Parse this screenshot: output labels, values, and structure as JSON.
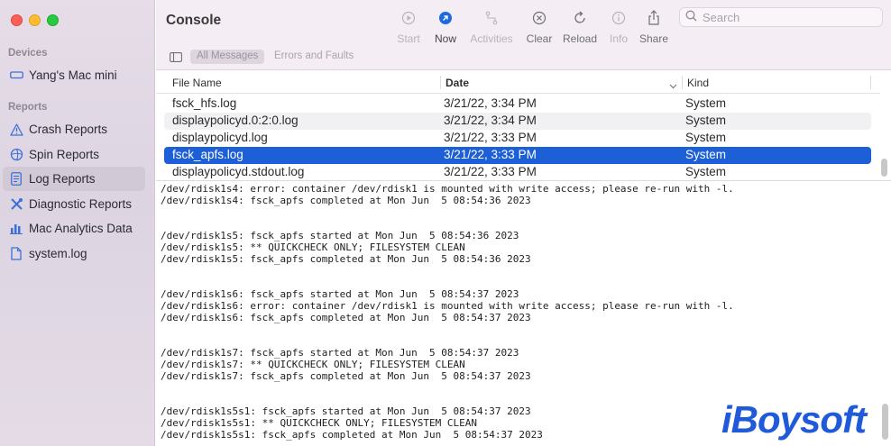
{
  "window": {
    "title": "Console",
    "traffic_lights": {
      "close": "#fd5f57",
      "minimize": "#febc2e",
      "zoom": "#28c840"
    }
  },
  "sidebar": {
    "devices_header": "Devices",
    "device": {
      "label": "Yang's Mac mini",
      "icon": "mac-mini-icon"
    },
    "reports_header": "Reports",
    "items": [
      {
        "label": "Crash Reports",
        "icon": "warning-triangle-icon",
        "selected": false
      },
      {
        "label": "Spin Reports",
        "icon": "spin-icon",
        "selected": false
      },
      {
        "label": "Log Reports",
        "icon": "log-document-icon",
        "selected": true
      },
      {
        "label": "Diagnostic Reports",
        "icon": "tools-icon",
        "selected": false
      },
      {
        "label": "Mac Analytics Data",
        "icon": "bar-chart-icon",
        "selected": false
      },
      {
        "label": "system.log",
        "icon": "file-icon",
        "selected": false
      }
    ]
  },
  "toolbar": {
    "start": "Start",
    "now": "Now",
    "activities": "Activities",
    "clear": "Clear",
    "reload": "Reload",
    "info": "Info",
    "share": "Share",
    "search_placeholder": "Search",
    "filters": {
      "all_messages": "All Messages",
      "errors_faults": "Errors and Faults"
    }
  },
  "table": {
    "columns": {
      "file_name": "File Name",
      "date": "Date",
      "kind": "Kind"
    },
    "sort_column": "Date",
    "rows": [
      {
        "file_name": "fsck_hfs.log",
        "date": "3/21/22, 3:34 PM",
        "kind": "System",
        "selected": false
      },
      {
        "file_name": "displaypolicyd.0:2:0.log",
        "date": "3/21/22, 3:34 PM",
        "kind": "System",
        "selected": false
      },
      {
        "file_name": "displaypolicyd.log",
        "date": "3/21/22, 3:33 PM",
        "kind": "System",
        "selected": false
      },
      {
        "file_name": "fsck_apfs.log",
        "date": "3/21/22, 3:33 PM",
        "kind": "System",
        "selected": true
      },
      {
        "file_name": "displaypolicyd.stdout.log",
        "date": "3/21/22, 3:33 PM",
        "kind": "System",
        "selected": false
      }
    ]
  },
  "log_lines": [
    "/dev/rdisk1s4: error: container /dev/rdisk1 is mounted with write access; please re-run with -l.",
    "/dev/rdisk1s4: fsck_apfs completed at Mon Jun  5 08:54:36 2023",
    "",
    "",
    "/dev/rdisk1s5: fsck_apfs started at Mon Jun  5 08:54:36 2023",
    "/dev/rdisk1s5: ** QUICKCHECK ONLY; FILESYSTEM CLEAN",
    "/dev/rdisk1s5: fsck_apfs completed at Mon Jun  5 08:54:36 2023",
    "",
    "",
    "/dev/rdisk1s6: fsck_apfs started at Mon Jun  5 08:54:37 2023",
    "/dev/rdisk1s6: error: container /dev/rdisk1 is mounted with write access; please re-run with -l.",
    "/dev/rdisk1s6: fsck_apfs completed at Mon Jun  5 08:54:37 2023",
    "",
    "",
    "/dev/rdisk1s7: fsck_apfs started at Mon Jun  5 08:54:37 2023",
    "/dev/rdisk1s7: ** QUICKCHECK ONLY; FILESYSTEM CLEAN",
    "/dev/rdisk1s7: fsck_apfs completed at Mon Jun  5 08:54:37 2023",
    "",
    "",
    "/dev/rdisk1s5s1: fsck_apfs started at Mon Jun  5 08:54:37 2023",
    "/dev/rdisk1s5s1: ** QUICKCHECK ONLY; FILESYSTEM CLEAN",
    "/dev/rdisk1s5s1: fsck_apfs completed at Mon Jun  5 08:54:37 2023"
  ],
  "watermark": "iBoysoft",
  "colors": {
    "selection": "#1d5fd6",
    "accent": "#1f5bd8"
  }
}
